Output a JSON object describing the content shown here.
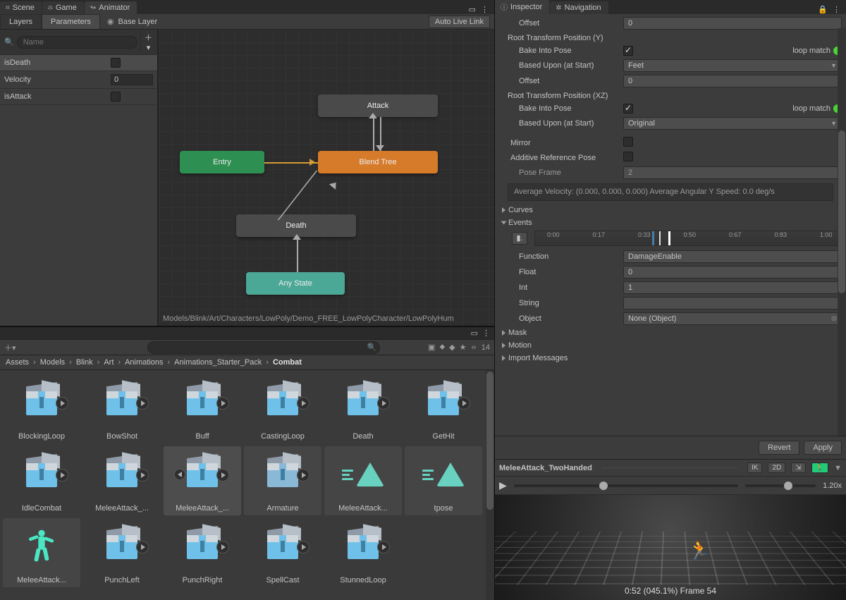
{
  "tabs": {
    "scene": "Scene",
    "game": "Game",
    "animator": "Animator"
  },
  "animator": {
    "layers": "Layers",
    "parameters": "Parameters",
    "base_layer": "Base Layer",
    "auto_live": "Auto Live Link",
    "search_placeholder": "Name",
    "params": [
      {
        "name": "isDeath",
        "type": "bool",
        "value": false
      },
      {
        "name": "Velocity",
        "type": "float",
        "value": "0"
      },
      {
        "name": "isAttack",
        "type": "bool",
        "value": false
      }
    ],
    "nodes": {
      "attack": "Attack",
      "blend": "Blend Tree",
      "entry": "Entry",
      "death": "Death",
      "any": "Any State"
    },
    "asset_path": "Models/Blink/Art/Characters/LowPoly/Demo_FREE_LowPolyCharacter/LowPolyHum"
  },
  "project": {
    "hidden_count": "14",
    "breadcrumb": [
      "Assets",
      "Models",
      "Blink",
      "Art",
      "Animations",
      "Animations_Starter_Pack",
      "Combat"
    ],
    "items": [
      {
        "label": "BlockingLoop",
        "kind": "fbx"
      },
      {
        "label": "BowShot",
        "kind": "fbx"
      },
      {
        "label": "Buff",
        "kind": "fbx"
      },
      {
        "label": "CastingLoop",
        "kind": "fbx"
      },
      {
        "label": "Death",
        "kind": "fbx"
      },
      {
        "label": "GetHit",
        "kind": "fbx"
      },
      {
        "label": "IdleCombat",
        "kind": "fbx"
      },
      {
        "label": "MeleeAttack_...",
        "kind": "fbx"
      },
      {
        "label": "MeleeAttack_...",
        "kind": "fbx",
        "selected": true,
        "expanded": true
      },
      {
        "label": "Armature",
        "kind": "fbx",
        "child": true
      },
      {
        "label": "MeleeAttack...",
        "kind": "clip",
        "child": true
      },
      {
        "label": "tpose",
        "kind": "clip",
        "child": true
      },
      {
        "label": "MeleeAttack...",
        "kind": "avatar",
        "hl": true
      },
      {
        "label": "PunchLeft",
        "kind": "fbx"
      },
      {
        "label": "PunchRight",
        "kind": "fbx"
      },
      {
        "label": "SpellCast",
        "kind": "fbx"
      },
      {
        "label": "StunnedLoop",
        "kind": "fbx"
      }
    ]
  },
  "inspector": {
    "tabs": {
      "inspector": "Inspector",
      "navigation": "Navigation"
    },
    "offset_label": "Offset",
    "offset_val": "0",
    "sectionY": "Root Transform Position (Y)",
    "sectionXZ": "Root Transform Position (XZ)",
    "bake": "Bake Into Pose",
    "based": "Based Upon (at Start)",
    "based_feet": "Feet",
    "based_original": "Original",
    "loop": "loop match",
    "mirror": "Mirror",
    "additive": "Additive Reference Pose",
    "pose_frame": "Pose Frame",
    "pose_frame_val": "2",
    "info": "Average Velocity: (0.000, 0.000, 0.000)\nAverage Angular Y Speed: 0.0 deg/s",
    "curves": "Curves",
    "events": "Events",
    "ticks": [
      "0:00",
      "0:17",
      "0:33",
      "0:50",
      "0:67",
      "0:83",
      "1:00"
    ],
    "function": "Function",
    "function_val": "DamageEnable",
    "float": "Float",
    "float_val": "0",
    "int": "Int",
    "int_val": "1",
    "string": "String",
    "string_val": "",
    "object": "Object",
    "object_val": "None (Object)",
    "mask": "Mask",
    "motion": "Motion",
    "import": "Import Messages",
    "revert": "Revert",
    "apply": "Apply"
  },
  "preview": {
    "title": "MeleeAttack_TwoHanded",
    "options": {
      "ik": "IK",
      "twod": "2D"
    },
    "speed": "1.20x",
    "frame": "0:52 (045.1%) Frame 54"
  }
}
